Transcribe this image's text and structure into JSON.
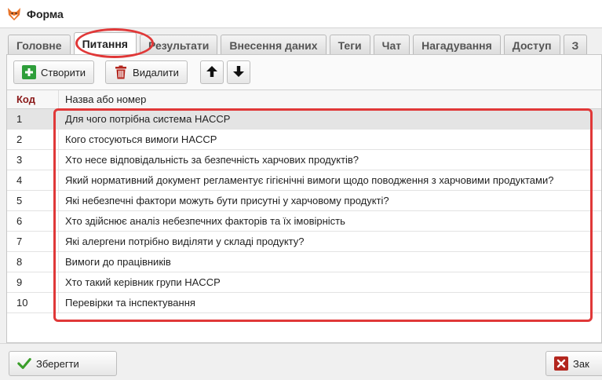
{
  "window": {
    "title": "Форма"
  },
  "tabs": [
    {
      "label": "Головне"
    },
    {
      "label": "Питання"
    },
    {
      "label": "Результати"
    },
    {
      "label": "Внесення даних"
    },
    {
      "label": "Теги"
    },
    {
      "label": "Чат"
    },
    {
      "label": "Нагадування"
    },
    {
      "label": "Доступ"
    },
    {
      "label": "З"
    }
  ],
  "active_tab": "Питання",
  "toolbar": {
    "create_label": "Створити",
    "delete_label": "Видалити"
  },
  "table": {
    "columns": [
      {
        "label": "Код"
      },
      {
        "label": "Назва або номер"
      }
    ],
    "rows": [
      {
        "code": "1",
        "name": "Для чого потрібна система HACCP"
      },
      {
        "code": "2",
        "name": "Кого стосуються вимоги HACCP"
      },
      {
        "code": "3",
        "name": "Хто несе відповідальність за безпечність харчових продуктів?"
      },
      {
        "code": "4",
        "name": "Який нормативний документ регламентує гігієнічні вимоги щодо поводження з харчовими продуктами?"
      },
      {
        "code": "5",
        "name": "Які небезпечні фактори можуть бути присутні у харчовому продукті?"
      },
      {
        "code": "6",
        "name": "Хто здійснює аналіз небезпечних факторів та їх імовірність"
      },
      {
        "code": "7",
        "name": "Які алергени потрібно виділяти у складі продукту?"
      },
      {
        "code": "8",
        "name": "Вимоги до працівників"
      },
      {
        "code": "9",
        "name": "Хто такий керівник групи HACCP"
      },
      {
        "code": "10",
        "name": "Перевірки та інспектування"
      }
    ]
  },
  "footer": {
    "save_label": "Зберегти",
    "close_label": "Зак"
  },
  "colors": {
    "highlight": "#e03838",
    "create_icon": "#2e9e3a",
    "delete_icon": "#b3261e",
    "code_header": "#8b1a1a"
  },
  "icons": {
    "app": "fox-icon",
    "create": "plus-icon",
    "delete": "trash-icon",
    "up": "arrow-up-icon",
    "down": "arrow-down-icon",
    "save": "checkmark-icon",
    "close": "close-icon"
  }
}
